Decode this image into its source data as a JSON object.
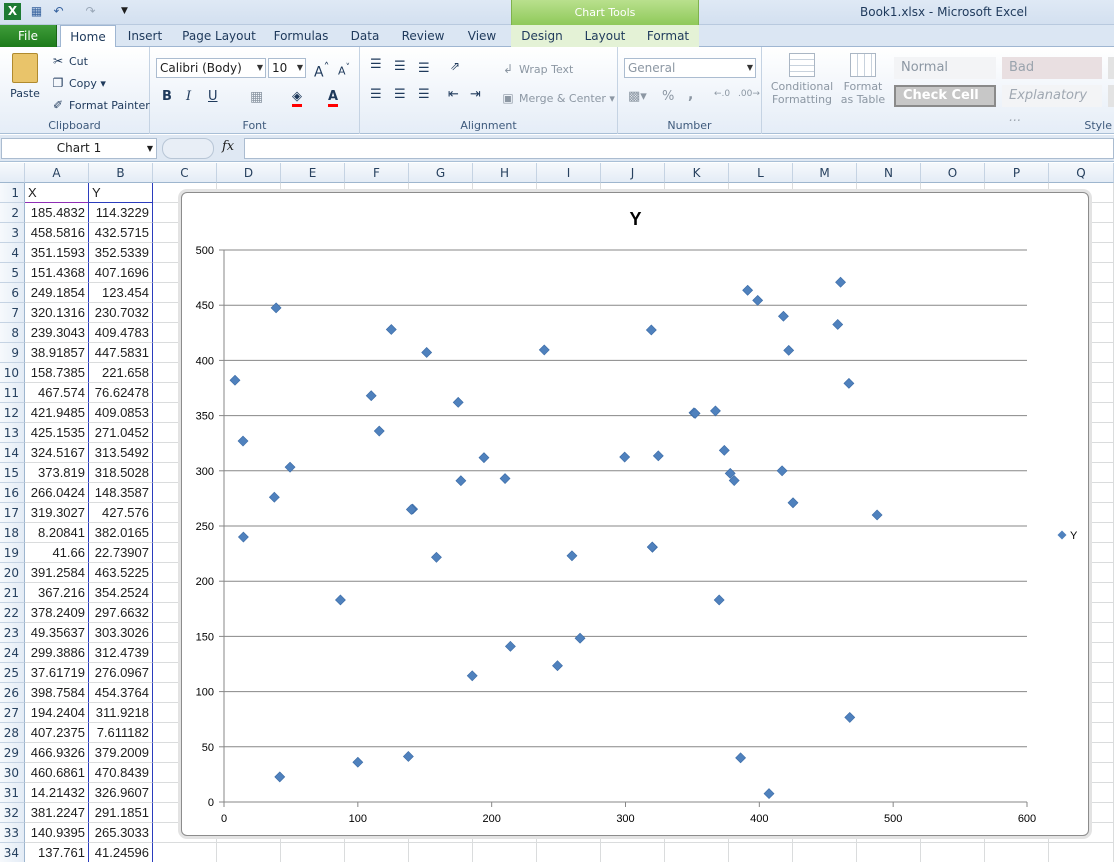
{
  "window": {
    "title": "Book1.xlsx  -  Microsoft Excel",
    "context_tab": "Chart Tools"
  },
  "ribbon_tabs": [
    "File",
    "Home",
    "Insert",
    "Page Layout",
    "Formulas",
    "Data",
    "Review",
    "View",
    "Design",
    "Layout",
    "Format"
  ],
  "clipboard": {
    "paste": "Paste",
    "cut": "Cut",
    "copy": "Copy",
    "format_painter": "Format Painter",
    "label": "Clipboard"
  },
  "font": {
    "name": "Calibri (Body)",
    "size": "10",
    "bold": "B",
    "italic": "I",
    "underline": "U",
    "label": "Font"
  },
  "alignment": {
    "wrap_text": "Wrap Text",
    "merge_center": "Merge & Center",
    "label": "Alignment"
  },
  "number": {
    "format": "General",
    "percent": "%",
    "comma": ",",
    "label": "Number"
  },
  "styles": {
    "conditional_formatting": "Conditional",
    "conditional_formatting_2": "Formatting",
    "format_as_table": "Format",
    "format_as_table_2": "as Table",
    "normal": "Normal",
    "bad": "Bad",
    "check_cell": "Check Cell",
    "explanatory": "Explanatory ...",
    "label": "Style"
  },
  "formula_bar": {
    "name_box": "Chart 1",
    "fx": "fx"
  },
  "columns": [
    "A",
    "B",
    "C",
    "D",
    "E",
    "F",
    "G",
    "H",
    "I",
    "J",
    "K",
    "L",
    "M",
    "N",
    "O",
    "P",
    "Q"
  ],
  "rows": [
    [
      "X",
      "Y"
    ],
    [
      "185.4832",
      "114.3229"
    ],
    [
      "458.5816",
      "432.5715"
    ],
    [
      "351.1593",
      "352.5339"
    ],
    [
      "151.4368",
      "407.1696"
    ],
    [
      "249.1854",
      "123.454"
    ],
    [
      "320.1316",
      "230.7032"
    ],
    [
      "239.3043",
      "409.4783"
    ],
    [
      "38.91857",
      "447.5831"
    ],
    [
      "158.7385",
      "221.658"
    ],
    [
      "467.574",
      "76.62478"
    ],
    [
      "421.9485",
      "409.0853"
    ],
    [
      "425.1535",
      "271.0452"
    ],
    [
      "324.5167",
      "313.5492"
    ],
    [
      "373.819",
      "318.5028"
    ],
    [
      "266.0424",
      "148.3587"
    ],
    [
      "319.3027",
      "427.576"
    ],
    [
      "8.20841",
      "382.0165"
    ],
    [
      "41.66",
      "22.73907"
    ],
    [
      "391.2584",
      "463.5225"
    ],
    [
      "367.216",
      "354.2524"
    ],
    [
      "378.2409",
      "297.6632"
    ],
    [
      "49.35637",
      "303.3026"
    ],
    [
      "299.3886",
      "312.4739"
    ],
    [
      "37.61719",
      "276.0967"
    ],
    [
      "398.7584",
      "454.3764"
    ],
    [
      "194.2404",
      "311.9218"
    ],
    [
      "407.2375",
      "7.611182"
    ],
    [
      "466.9326",
      "379.2009"
    ],
    [
      "460.6861",
      "470.8439"
    ],
    [
      "14.21432",
      "326.9607"
    ],
    [
      "381.2247",
      "291.1851"
    ],
    [
      "140.9395",
      "265.3033"
    ],
    [
      "137.761",
      "41.24596"
    ]
  ],
  "chart_data": {
    "type": "scatter",
    "title": "Y",
    "xlabel": "",
    "ylabel": "",
    "xlim": [
      0,
      600
    ],
    "ylim": [
      0,
      500
    ],
    "x_ticks": [
      0,
      100,
      200,
      300,
      400,
      500,
      600
    ],
    "y_ticks": [
      0,
      50,
      100,
      150,
      200,
      250,
      300,
      350,
      400,
      450,
      500
    ],
    "grid": "horizontal major",
    "legend": "right",
    "marker": "diamond",
    "color": "#4f81bd",
    "series": [
      {
        "name": "Y",
        "points": [
          [
            185.4832,
            114.3229
          ],
          [
            458.5816,
            432.5715
          ],
          [
            351.1593,
            352.5339
          ],
          [
            151.4368,
            407.1696
          ],
          [
            249.1854,
            123.454
          ],
          [
            320.1316,
            230.7032
          ],
          [
            239.3043,
            409.4783
          ],
          [
            38.91857,
            447.5831
          ],
          [
            158.7385,
            221.658
          ],
          [
            467.574,
            76.62478
          ],
          [
            421.9485,
            409.0853
          ],
          [
            425.1535,
            271.0452
          ],
          [
            324.5167,
            313.5492
          ],
          [
            373.819,
            318.5028
          ],
          [
            266.0424,
            148.3587
          ],
          [
            319.3027,
            427.576
          ],
          [
            8.20841,
            382.0165
          ],
          [
            41.66,
            22.73907
          ],
          [
            391.2584,
            463.5225
          ],
          [
            367.216,
            354.2524
          ],
          [
            378.2409,
            297.6632
          ],
          [
            49.35637,
            303.3026
          ],
          [
            299.3886,
            312.4739
          ],
          [
            37.61719,
            276.0967
          ],
          [
            398.7584,
            454.3764
          ],
          [
            194.2404,
            311.9218
          ],
          [
            407.2375,
            7.611182
          ],
          [
            466.9326,
            379.2009
          ],
          [
            460.6861,
            470.8439
          ],
          [
            14.21432,
            326.9607
          ],
          [
            381.2247,
            291.1851
          ],
          [
            140.9395,
            265.3033
          ],
          [
            137.761,
            41.24596
          ],
          [
            14.5,
            240
          ],
          [
            87,
            183
          ],
          [
            100,
            36
          ],
          [
            110,
            368
          ],
          [
            116,
            336
          ],
          [
            125,
            428
          ],
          [
            140,
            265
          ],
          [
            175,
            362
          ],
          [
            177,
            291
          ],
          [
            210,
            293
          ],
          [
            214,
            141
          ],
          [
            260,
            223
          ],
          [
            320,
            231
          ],
          [
            352,
            352
          ],
          [
            370,
            183
          ],
          [
            386,
            40
          ],
          [
            417,
            300
          ],
          [
            418,
            440
          ],
          [
            488,
            260
          ]
        ]
      }
    ]
  }
}
